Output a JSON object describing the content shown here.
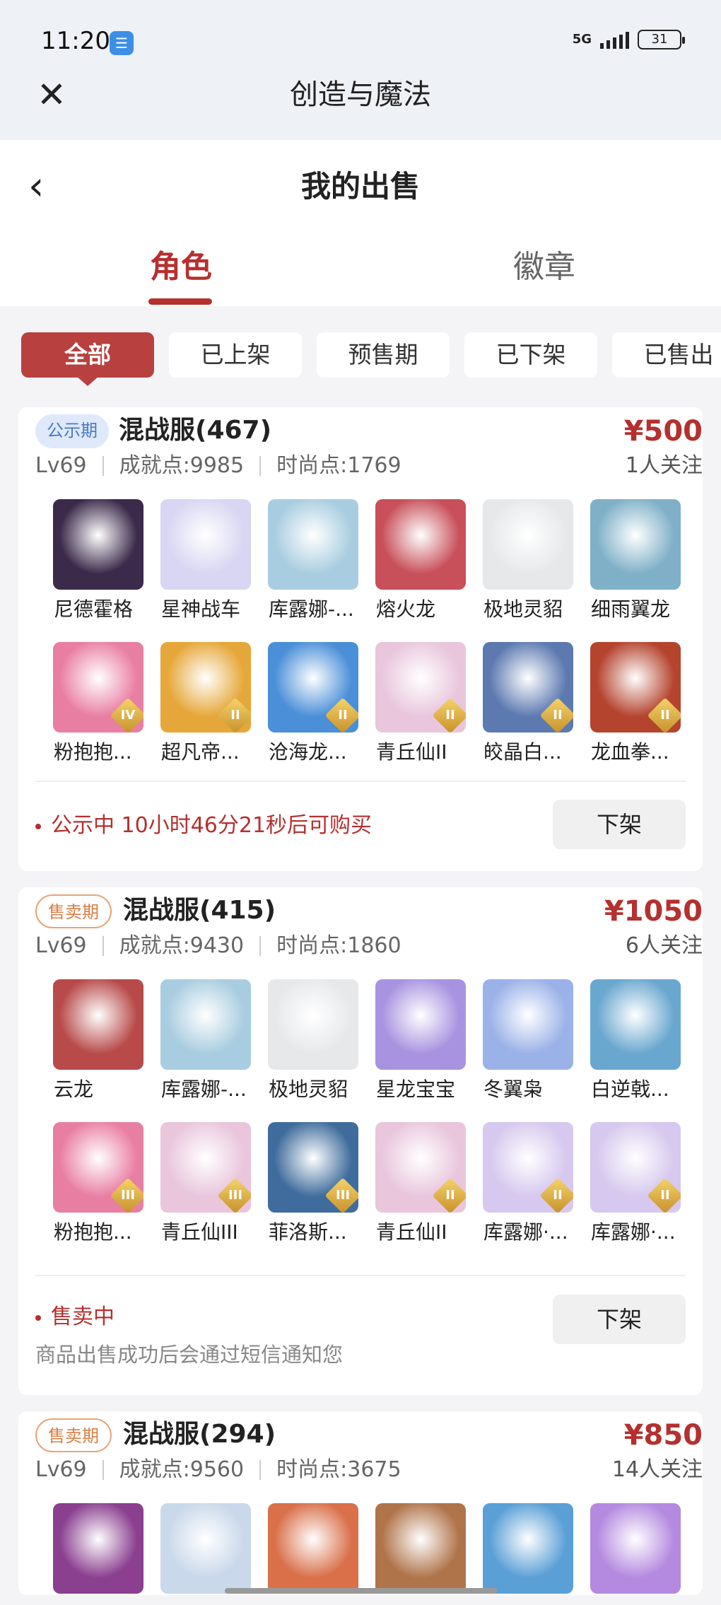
{
  "status_bar": {
    "time": "11:20",
    "network": "5G",
    "battery": "31"
  },
  "mini_bar": {
    "title": "创造与魔法"
  },
  "header": {
    "title": "我的出售"
  },
  "tabs": [
    {
      "label": "角色"
    },
    {
      "label": "徽章"
    }
  ],
  "filters": [
    {
      "label": "全部"
    },
    {
      "label": "已上架"
    },
    {
      "label": "预售期"
    },
    {
      "label": "已下架"
    },
    {
      "label": "已售出"
    }
  ],
  "listings": [
    {
      "phase": "公示期",
      "server": "混战服(467)",
      "price": "¥500",
      "followers": "1人关注",
      "level": "Lv69",
      "achievement": "成就点:9985",
      "fashion": "时尚点:1769",
      "pets_row1": [
        {
          "name": "尼德霍格",
          "color": "#3b2a4a"
        },
        {
          "name": "星神战车",
          "color": "#d8d6f2"
        },
        {
          "name": "库露娜-...",
          "color": "#a9cde0"
        },
        {
          "name": "熔火龙",
          "color": "#c8505a"
        },
        {
          "name": "极地灵貂",
          "color": "#e6e8ea"
        },
        {
          "name": "细雨翼龙",
          "color": "#7fb0c8"
        }
      ],
      "pets_row2": [
        {
          "name": "粉抱抱...",
          "color": "#e97ea3",
          "tier": "IV"
        },
        {
          "name": "超凡帝...",
          "color": "#e6a73a",
          "tier": "II"
        },
        {
          "name": "沧海龙...",
          "color": "#4a8fd8",
          "tier": "II"
        },
        {
          "name": "青丘仙II",
          "color": "#e9c6dc",
          "tier": "II"
        },
        {
          "name": "皎晶白...",
          "color": "#5c79b0",
          "tier": "II"
        },
        {
          "name": "龙血拳...",
          "color": "#b5442f",
          "tier": "II"
        }
      ],
      "status": "公示中 10小时46分21秒后可购买",
      "delist_label": "下架"
    },
    {
      "phase": "售卖期",
      "server": "混战服(415)",
      "price": "¥1050",
      "followers": "6人关注",
      "level": "Lv69",
      "achievement": "成就点:9430",
      "fashion": "时尚点:1860",
      "pets_row1": [
        {
          "name": "云龙",
          "color": "#b84a4a"
        },
        {
          "name": "库露娜-...",
          "color": "#a9cde0"
        },
        {
          "name": "极地灵貂",
          "color": "#e6e8ea"
        },
        {
          "name": "星龙宝宝",
          "color": "#a893e0"
        },
        {
          "name": "冬翼枭",
          "color": "#9bb2e8"
        },
        {
          "name": "白逆戟...",
          "color": "#6aa7cf"
        }
      ],
      "pets_row2": [
        {
          "name": "粉抱抱...",
          "color": "#e97ea3",
          "tier": "III"
        },
        {
          "name": "青丘仙III",
          "color": "#e9c6dc",
          "tier": "III"
        },
        {
          "name": "菲洛斯...",
          "color": "#3f6c9c",
          "tier": "III"
        },
        {
          "name": "青丘仙II",
          "color": "#e9c6dc",
          "tier": "II"
        },
        {
          "name": "库露娜·...",
          "color": "#d6c8ee",
          "tier": "II"
        },
        {
          "name": "库露娜·...",
          "color": "#d6c8ee",
          "tier": "II"
        }
      ],
      "status": "售卖中",
      "note": "商品出售成功后会通过短信通知您",
      "delist_label": "下架"
    },
    {
      "phase": "售卖期",
      "server": "混战服(294)",
      "price": "¥850",
      "followers": "14人关注",
      "level": "Lv69",
      "achievement": "成就点:9560",
      "fashion": "时尚点:3675",
      "pets_row1": [
        {
          "name": "",
          "color": "#8a3f8f"
        },
        {
          "name": "",
          "color": "#c9d8ea"
        },
        {
          "name": "",
          "color": "#d9704a"
        },
        {
          "name": "",
          "color": "#b0744a"
        },
        {
          "name": "",
          "color": "#5a9fd6"
        },
        {
          "name": "",
          "color": "#b48ae0"
        }
      ]
    }
  ]
}
